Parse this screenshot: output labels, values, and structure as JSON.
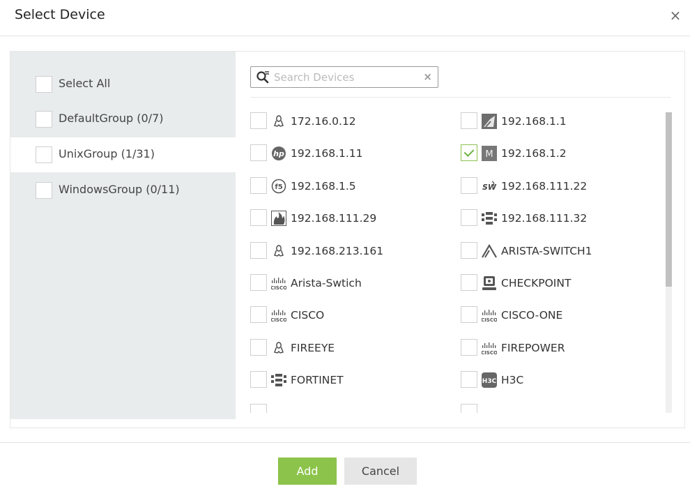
{
  "dialog": {
    "title": "Select Device",
    "close_glyph": "×"
  },
  "groups": [
    {
      "label": "Select All",
      "checked": false,
      "active": false
    },
    {
      "label": "DefaultGroup (0/7)",
      "checked": false,
      "active": false
    },
    {
      "label": "UnixGroup (1/31)",
      "checked": false,
      "active": true
    },
    {
      "label": "WindowsGroup (0/11)",
      "checked": false,
      "active": false
    }
  ],
  "search": {
    "placeholder": "Search Devices",
    "value": "",
    "clear_glyph": "×"
  },
  "devices": [
    {
      "name": "172.16.0.12",
      "icon": "linux-icon",
      "checked": false
    },
    {
      "name": "192.168.1.1",
      "icon": "network-device-icon",
      "checked": false
    },
    {
      "name": "192.168.1.11",
      "icon": "hp-icon",
      "checked": false
    },
    {
      "name": "192.168.1.2",
      "icon": "m-icon",
      "checked": true
    },
    {
      "name": "192.168.1.5",
      "icon": "f5-icon",
      "checked": false
    },
    {
      "name": "192.168.111.22",
      "icon": "sw-icon",
      "checked": false
    },
    {
      "name": "192.168.111.29",
      "icon": "firewall-icon",
      "checked": false
    },
    {
      "name": "192.168.111.32",
      "icon": "fortinet-icon",
      "checked": false
    },
    {
      "name": "192.168.213.161",
      "icon": "linux-icon",
      "checked": false
    },
    {
      "name": "ARISTA-SWITCH1",
      "icon": "arista-icon",
      "checked": false
    },
    {
      "name": "Arista-Swtich",
      "icon": "cisco-icon",
      "checked": false
    },
    {
      "name": "CHECKPOINT",
      "icon": "checkpoint-icon",
      "checked": false
    },
    {
      "name": "CISCO",
      "icon": "cisco-icon",
      "checked": false
    },
    {
      "name": "CISCO-ONE",
      "icon": "cisco-icon",
      "checked": false
    },
    {
      "name": "FIREEYE",
      "icon": "linux-icon",
      "checked": false
    },
    {
      "name": "FIREPOWER",
      "icon": "cisco-icon",
      "checked": false
    },
    {
      "name": "FORTINET",
      "icon": "fortinet-icon",
      "checked": false
    },
    {
      "name": "H3C",
      "icon": "h3c-icon",
      "checked": false
    }
  ],
  "icon_text": {
    "cisco": "ılıılı CISCO",
    "hp": "hp",
    "sw": "SW",
    "m": "M",
    "h3c": "H3C",
    "f5": "f5"
  },
  "buttons": {
    "add_label": "Add",
    "cancel_label": "Cancel"
  },
  "colors": {
    "accent_green": "#8cc34a",
    "sidebar_bg": "#e9ecec"
  }
}
